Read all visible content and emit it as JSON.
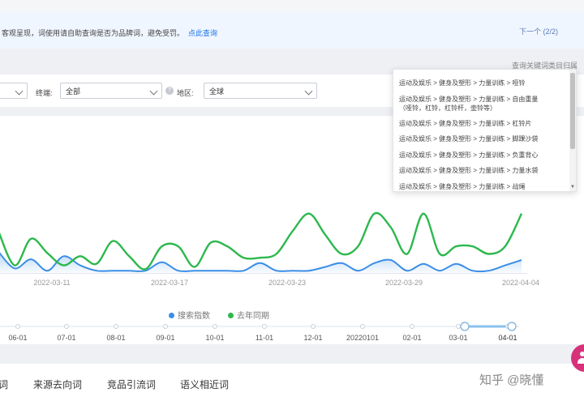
{
  "notice": {
    "message": "客观呈现，词使用请自助查询是否为品牌词，避免受罚。",
    "link": "点此查询",
    "pager": "下一个 (2/2)"
  },
  "category_hint": "查询关键词类目归属",
  "filters": {
    "terminal_label": "终端:",
    "terminal_value": "全部",
    "region_label": "地区:",
    "region_value": "全球"
  },
  "dropdown": {
    "items": [
      [
        "运动及娱乐 > 健身及塑形 > 力量训练 > 哑铃"
      ],
      [
        "运动及娱乐 > 健身及塑形 > 力量训练 > 自由重量",
        "（哑铃，杠铃，杠铃杆，壶铃等）"
      ],
      [
        "运动及娱乐 > 健身及塑形 > 力量训练 > 杠铃片"
      ],
      [
        "运动及娱乐 > 健身及塑形 > 力量训练 > 脚踝沙袋"
      ],
      [
        "运动及娱乐 > 健身及塑形 > 力量训练 > 负重背心"
      ],
      [
        "运动及娱乐 > 健身及塑形 > 力量训练 > 力量水袋"
      ],
      [
        "运动及娱乐 > 健身及塑形 > 力量训练 > 战绳"
      ]
    ]
  },
  "chart_data": {
    "type": "area",
    "x_tick_labels": [
      "2022-03-11",
      "2022-03-17",
      "2022-03-23",
      "2022-03-29",
      "2022-04-04"
    ],
    "series": [
      {
        "name": "搜索指数",
        "color": "#3a8ee6",
        "values": [
          28,
          6,
          18,
          3,
          22,
          10,
          3,
          3,
          3,
          3,
          14,
          3,
          3,
          3,
          3,
          3,
          13,
          3,
          3,
          3,
          8,
          13,
          3,
          13,
          17,
          3,
          12,
          3,
          12,
          3,
          3,
          10,
          17
        ]
      },
      {
        "name": "去年同期",
        "color": "#2db84d",
        "values": [
          55,
          10,
          45,
          26,
          10,
          22,
          12,
          42,
          22,
          5,
          35,
          35,
          8,
          40,
          35,
          20,
          20,
          25,
          55,
          78,
          50,
          25,
          35,
          78,
          60,
          25,
          78,
          25,
          35,
          35,
          25,
          35,
          78
        ]
      }
    ],
    "ylim": [
      0,
      100
    ],
    "legend_position": "bottom"
  },
  "timeline": {
    "labels": [
      "06-01",
      "07-01",
      "08-01",
      "09-01",
      "10-01",
      "11-01",
      "12-01",
      "20220101",
      "02-01",
      "03-01",
      "04-01"
    ]
  },
  "tabs": [
    "词",
    "来源去向词",
    "竞品引流词",
    "语义相近词"
  ],
  "watermark": "知乎 @晓懂"
}
